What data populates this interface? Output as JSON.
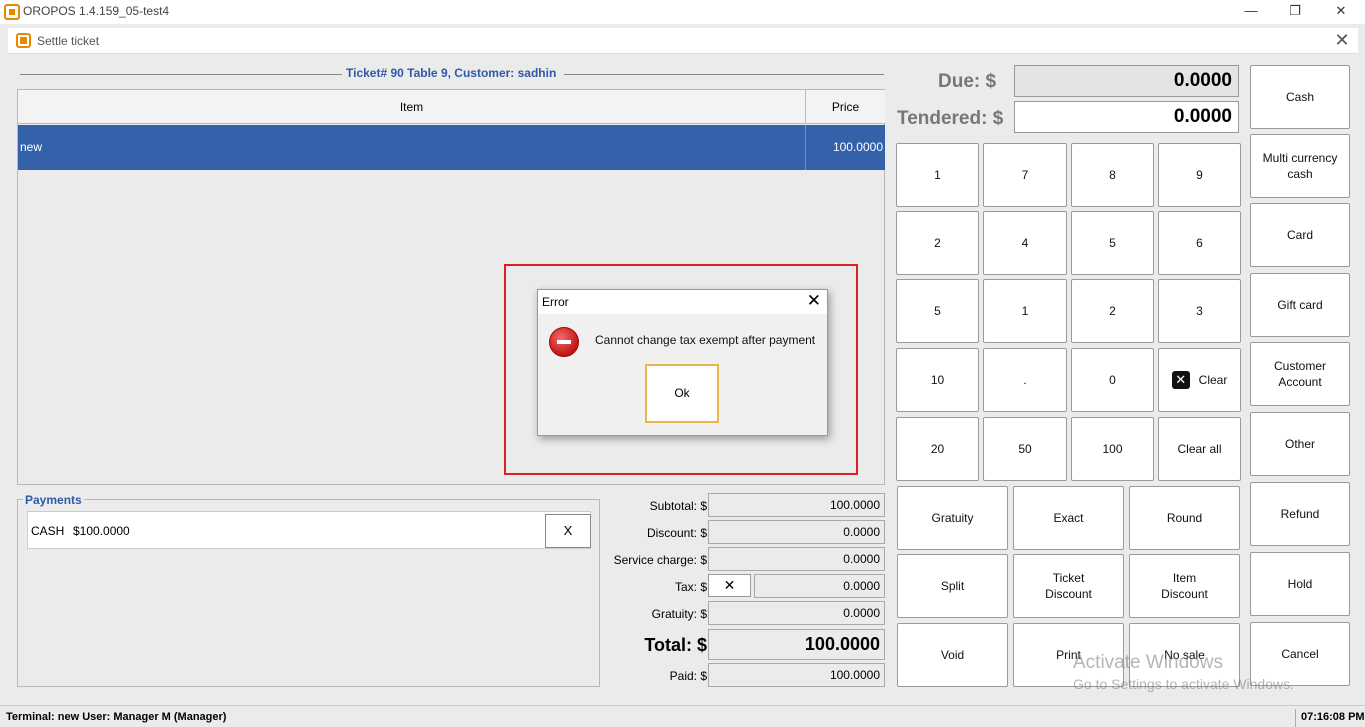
{
  "window": {
    "title": "OROPOS 1.4.159_05-test4",
    "minimize": "—",
    "restore": "❐",
    "close": "✕"
  },
  "dialog": {
    "title": "Settle ticket",
    "close": "✕"
  },
  "ticket": {
    "heading": "Ticket# 90 Table 9, Customer: sadhin",
    "columns": {
      "item": "Item",
      "price": "Price"
    },
    "rows": [
      {
        "item": "new",
        "price": "100.0000"
      }
    ]
  },
  "error": {
    "title": "Error",
    "close": "✕",
    "message": "Cannot change tax exempt after payment",
    "ok": "Ok"
  },
  "payments": {
    "label": "Payments",
    "rows": [
      {
        "type": "CASH",
        "amount": "$100.0000",
        "remove": "X"
      }
    ]
  },
  "totals": {
    "subtotal_label": "Subtotal: $",
    "subtotal": "100.0000",
    "discount_label": "Discount: $",
    "discount": "0.0000",
    "service_label": "Service charge: $",
    "service": "0.0000",
    "tax_label": "Tax: $",
    "tax_exempt_btn": "✕",
    "tax": "0.0000",
    "gratuity_label": "Gratuity: $",
    "gratuity": "0.0000",
    "total_label": "Total: $",
    "total": "100.0000",
    "paid_label": "Paid: $",
    "paid": "100.0000"
  },
  "amounts": {
    "due_label": "Due: $",
    "due": "0.0000",
    "tendered_label": "Tendered: $",
    "tendered": "0.0000"
  },
  "keypad": {
    "quick": [
      "1",
      "2",
      "5",
      "10",
      "20"
    ],
    "r1": [
      "7",
      "8",
      "9"
    ],
    "r2": [
      "4",
      "5",
      "6"
    ],
    "r3": [
      "1",
      "2",
      "3"
    ],
    "r4": [
      ".",
      "0"
    ],
    "clear": "Clear",
    "fifty": "50",
    "hundred": "100",
    "clear_all": "Clear all"
  },
  "actions": {
    "gratuity": "Gratuity",
    "exact": "Exact",
    "round": "Round",
    "split": "Split",
    "ticket_discount": "Ticket\nDiscount",
    "item_discount": "Item\nDiscount",
    "void": "Void",
    "print": "Print",
    "no_sale": "No sale"
  },
  "payment_methods": [
    "Cash",
    "Multi currency cash",
    "Card",
    "Gift card",
    "Customer Account",
    "Other",
    "Refund",
    "Hold",
    "Cancel"
  ],
  "status": {
    "left": "Terminal: new User: Manager M (Manager)",
    "time": "07:16:08 PM"
  },
  "watermark": {
    "line1": "Activate Windows",
    "line2": "Go to Settings to activate Windows."
  }
}
